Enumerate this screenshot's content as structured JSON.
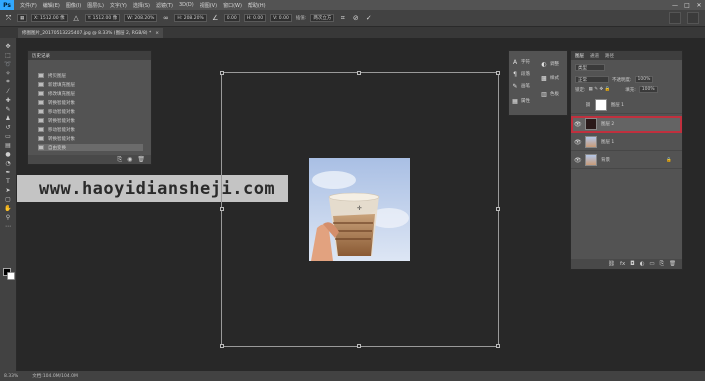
{
  "app": {
    "logo": "Ps",
    "menu": [
      "文件(F)",
      "编辑(E)",
      "图像(I)",
      "图层(L)",
      "文字(Y)",
      "选择(S)",
      "滤镜(T)",
      "3D(D)",
      "视图(V)",
      "窗口(W)",
      "帮助(H)"
    ],
    "window_controls": [
      "—",
      "□",
      "✕"
    ]
  },
  "options_bar": {
    "x_value": "X: 1512.00 像",
    "y_value": "Y: 1512.00 像",
    "w_value": "W: 208.20%",
    "h_value": "H: 208.20%",
    "angle_value": "0.00",
    "h_skew_value": "H: 0.00",
    "v_skew_value": "V: 0.00",
    "interp_label": "插值:",
    "interp_value": "两次立方",
    "cancel_icon": "cancel-icon",
    "commit_icon": "commit-icon"
  },
  "document": {
    "tab_title": "修图图片_20170513225407.jpg @ 8.33% (图层 2, RGB/8) *",
    "close_glyph": "×"
  },
  "history": {
    "title": "历史记录",
    "items": [
      {
        "label": "拷贝图层",
        "selected": false
      },
      {
        "label": "新建填充图层",
        "selected": false
      },
      {
        "label": "修改填充图层",
        "selected": false
      },
      {
        "label": "转换智能对象",
        "selected": false
      },
      {
        "label": "移动智能对象",
        "selected": false
      },
      {
        "label": "转换智能对象",
        "selected": false
      },
      {
        "label": "移动智能对象",
        "selected": false
      },
      {
        "label": "转换智能对象",
        "selected": false
      },
      {
        "label": "自由变换",
        "selected": true
      }
    ]
  },
  "watermark": "www.haoyidiansheji.com",
  "adjust_panel": {
    "rows": [
      {
        "icon": "character-icon",
        "glyph": "A",
        "label": "字符"
      },
      {
        "icon": "paragraph-icon",
        "glyph": "¶",
        "label": "段落"
      },
      {
        "icon": "brush-icon",
        "glyph": "✎",
        "label": "画笔"
      },
      {
        "icon": "properties-icon",
        "glyph": "▦",
        "label": "属性"
      }
    ],
    "side_rows": [
      {
        "icon": "adjustment-icon",
        "glyph": "◐",
        "label": "调整"
      },
      {
        "icon": "styles-icon",
        "glyph": "▩",
        "label": "样式"
      },
      {
        "icon": "swatches-icon",
        "glyph": "▥",
        "label": "色板"
      }
    ]
  },
  "layers_panel": {
    "tabs": [
      "图层",
      "通道",
      "路径"
    ],
    "kind_label": "类型",
    "blend_mode": "正常",
    "opacity_label": "不透明度:",
    "opacity_value": "100%",
    "lock_label": "锁定:",
    "fill_label": "填充:",
    "fill_value": "100%",
    "layers": [
      {
        "name": "图层 1",
        "visible": false,
        "thumb": "white",
        "linked": true,
        "selected": false
      },
      {
        "name": "图层 2",
        "visible": true,
        "thumb": "dark",
        "linked": false,
        "selected": true
      },
      {
        "name": "图层 1",
        "visible": true,
        "thumb": "photo",
        "linked": false,
        "selected": false
      },
      {
        "name": "背景",
        "visible": true,
        "thumb": "photo",
        "linked": false,
        "selected": false,
        "locked": true
      }
    ]
  },
  "status": {
    "zoom": "8.33%",
    "doc_size": "文档:104.0M/104.0M"
  },
  "colors": {
    "accent_selection": "#c0303e",
    "canvas_bg": "#282828"
  }
}
